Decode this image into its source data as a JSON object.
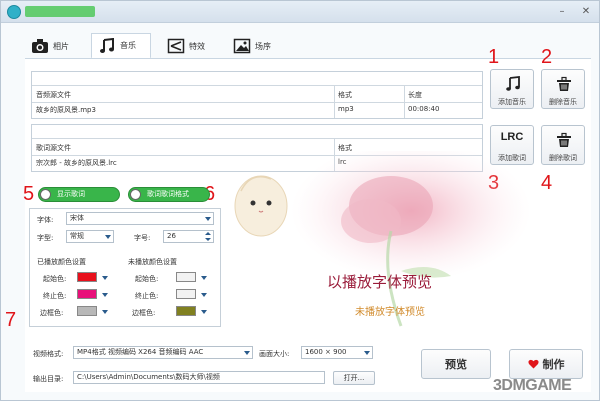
{
  "window": {
    "title": "",
    "minimize": "–",
    "close": "✕"
  },
  "tabs": [
    {
      "label": "相片",
      "icon": "camera-icon"
    },
    {
      "label": "音乐",
      "icon": "music-note-icon",
      "active": true
    },
    {
      "label": "特效",
      "icon": "effect-icon"
    },
    {
      "label": "场序",
      "icon": "picture-icon"
    }
  ],
  "audio_table": {
    "headers": [
      "音频源文件",
      "格式",
      "长度"
    ],
    "row": [
      "故乡的原风景.mp3",
      "mp3",
      "00:08:40"
    ]
  },
  "lyrics_table": {
    "headers": [
      "歌词源文件",
      "格式"
    ],
    "row": [
      "宗次郎 - 故乡的原风景.lrc",
      "lrc"
    ]
  },
  "buttons": {
    "add_music": "添加音乐",
    "delete_music": "删除音乐",
    "add_lyrics": "添加歌词",
    "delete_lyrics": "删除歌词",
    "lrc_text": "LRC",
    "browse": "打开...",
    "preview": "预览",
    "make": "制作"
  },
  "annotations": [
    "1",
    "2",
    "3",
    "4",
    "5",
    "6",
    "7"
  ],
  "toggles": {
    "show_lyrics": "显示歌词",
    "lyrics_style": "歌词歌词格式"
  },
  "font_panel": {
    "font_label": "字体:",
    "font_value": "宋体",
    "weight_label": "字型:",
    "weight_value": "常规",
    "size_label": "字号:",
    "size_value": "26",
    "played_title": "已播放颜色设置",
    "unplayed_title": "未播放颜色设置",
    "start_label": "起始色:",
    "end_label": "终止色:",
    "border_label": "边框色:"
  },
  "colors": {
    "played_start": "#e8101c",
    "played_end": "#e8107a",
    "played_border": "#b8b8b8",
    "unplayed_start": "#f2f2f2",
    "unplayed_end": "#f2f2f2",
    "unplayed_border": "#808020",
    "accent_red": "#e0151a",
    "toggle_green": "#39b54a"
  },
  "preview": {
    "played_text": "以播放字体预览",
    "unplayed_text": "未播放字体预览"
  },
  "output": {
    "format_label": "视频格式:",
    "format_value": "MP4格式 视频编码 X264 音频编码 AAC",
    "size_label": "画面大小:",
    "size_value": "1600 × 900",
    "path_label": "输出目录:",
    "path_value": "C:\\Users\\Admin\\Documents\\数码大师\\视频"
  },
  "watermark": "3DMGAME"
}
